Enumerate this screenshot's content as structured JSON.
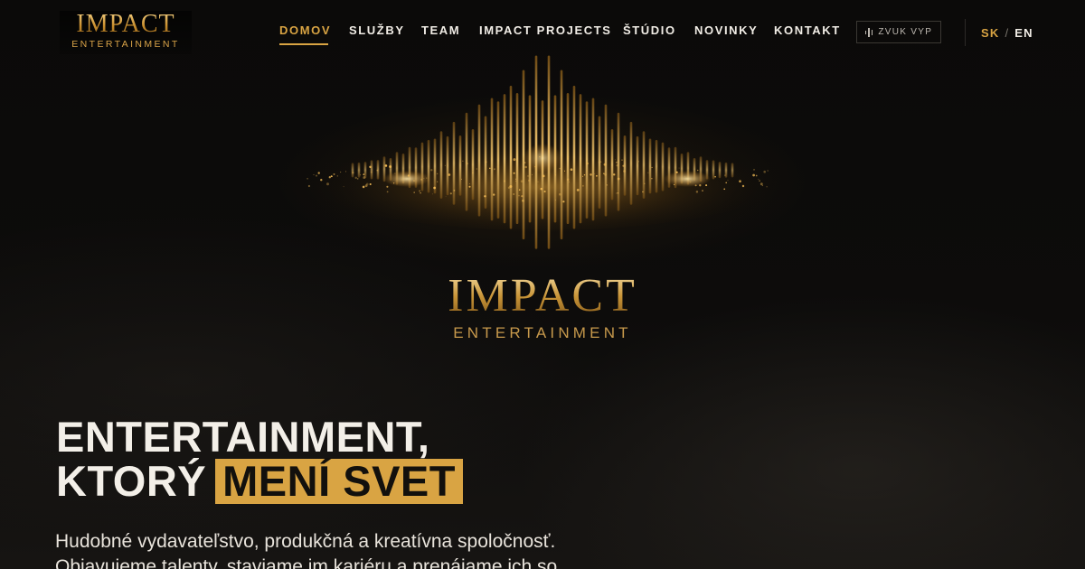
{
  "brand": {
    "logo_main": "IMPACT",
    "logo_sub": "ENTERTAINMENT"
  },
  "nav": {
    "items": [
      {
        "label": "DOMOV",
        "active": true
      },
      {
        "label": "SLUŽBY",
        "active": false
      },
      {
        "label": "TEAM",
        "active": false
      },
      {
        "label": "IMPACT PROJECTS",
        "active": false
      },
      {
        "label": "ŠTÚDIO",
        "active": false
      },
      {
        "label": "NOVINKY",
        "active": false
      },
      {
        "label": "KONTAKT",
        "active": false
      }
    ],
    "sound_button": {
      "label": "ZVUK VYP",
      "icon": "sound-wave-icon"
    },
    "languages": {
      "sk": "SK",
      "separator": "/",
      "en": "EN",
      "active": "SK"
    }
  },
  "emblem": {
    "icon": "golden-soundwave-icon",
    "title": "IMPACT",
    "subtitle": "ENTERTAINMENT"
  },
  "hero": {
    "line1": "ENTERTAINMENT,",
    "line2_plain": "KTORÝ",
    "line2_highlight": "MENÍ SVET",
    "description": "Hudobné vydavateľstvo, produkčná a kreatívna spoločnosť. Objavujeme talenty, staviame im kariéru a prenájame ich so"
  },
  "colors": {
    "accent": "#d9a443",
    "background": "#0a0908",
    "text": "#f1ede6"
  }
}
